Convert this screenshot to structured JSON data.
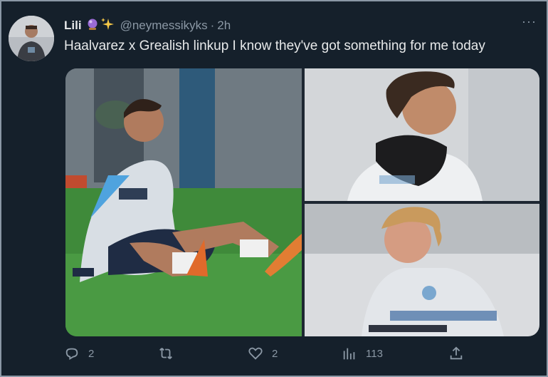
{
  "tweet": {
    "display_name": "Lili",
    "emojis": [
      "crystal-ball",
      "sparkles"
    ],
    "handle": "@neymessikyks",
    "separator": "·",
    "time": "2h",
    "text": "Haalvarez x Grealish linkup I know they've got something for me today",
    "more_label": "···"
  },
  "actions": {
    "reply_count": "2",
    "retweet_count": "",
    "like_count": "2",
    "views_count": "113"
  },
  "icons": [
    "avatar",
    "crystal-ball-icon",
    "sparkles-icon",
    "more-icon",
    "reply-icon",
    "retweet-icon",
    "like-icon",
    "views-icon",
    "share-icon"
  ],
  "colors": {
    "background": "#15202b",
    "text": "#e7e9ea",
    "muted": "#8b98a5"
  }
}
